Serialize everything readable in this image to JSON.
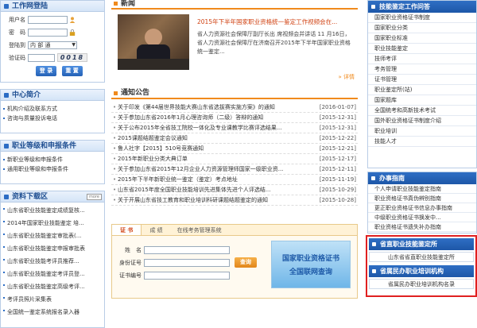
{
  "login": {
    "title": "工作网登陆",
    "user_label": "用户名",
    "pwd_label": "密　码",
    "dept_label": "登陆到",
    "dept_value": "内 部 通",
    "code_label": "验证码",
    "code_value": "0018",
    "login_btn": "登 录",
    "reset_btn": "重 置"
  },
  "center": {
    "title": "中心简介",
    "items": [
      "机构介绍及联系方式",
      "咨询与质量投诉电话"
    ]
  },
  "grade": {
    "title": "职业等级和申报条件",
    "items": [
      "新职业等级和申报条件",
      "通用职业等级和申报条件"
    ]
  },
  "downloads": {
    "title": "资料下载区",
    "more": "more",
    "items": [
      "山东省职业技能鉴定成绩复核...",
      "2014年国家职业技能鉴定 培...",
      "山东省职业技能鉴定审批表(...",
      "山东省职业技能鉴定申报审批表",
      "山东省职业技能考评员推荐...",
      "山东省职业技能鉴定考评员登...",
      "山东省职业技能鉴定高级考评...",
      "考评员照片采集表",
      "全国统一鉴定系统报名录入器"
    ]
  },
  "news": {
    "title": "新闻",
    "more": "详情",
    "headline": "2015年下半年国家职业资格统一鉴定工作视频会在...",
    "summary": "省人力资源社会保障厅副厅长出 席视频会并讲话 11 月16日，省人力资源社会保障厅在济南召开2015年下半年国家职业资格统一鉴定..."
  },
  "notice": {
    "title": "通知公告",
    "items": [
      {
        "t": "关于印发《第44届世界技能大赛山东省选拔赛实施方案》的通知",
        "d": "[2016-01-07]"
      },
      {
        "t": "关于参加山东省2016年1月心理咨询师（二级）答辩的通知",
        "d": "[2015-12-31]"
      },
      {
        "t": "关于公布2015年全省技工院校一体化及专业课教学比赛评选结果...",
        "d": "[2015-12-31]"
      },
      {
        "t": "2015课题结题鉴定会议通知",
        "d": "[2015-12-22]"
      },
      {
        "t": "鲁人社字【2015】510号竞赛通知",
        "d": "[2015-12-21]"
      },
      {
        "t": "2015年新职业分类大典订单",
        "d": "[2015-12-17]"
      },
      {
        "t": "关于参加山东省2015年12月企业人力资源管理师国家一级职业资...",
        "d": "[2015-12-11]"
      },
      {
        "t": "2015年下半年新职业统一鉴定（鉴定）考点地址",
        "d": "[2015-11-19]"
      },
      {
        "t": "山东省2015年度全国职业技能培训先进集体先进个人评选结...",
        "d": "[2015-10-29]"
      },
      {
        "t": "关于开展山东省技工教育和职业培训科研课题结题鉴定的通知",
        "d": "[2015-10-28]"
      }
    ]
  },
  "query": {
    "tabs": [
      "证 书",
      "成 绩",
      "在线考务管理系统"
    ],
    "name_label": "姓　名",
    "id_label": "身份证号",
    "cert_label": "证书编号",
    "query_btn": "查询",
    "banner_line1": "国家职业资格证书",
    "banner_line2": "全国联网查询"
  },
  "skills": {
    "title": "技能鉴定工作问答",
    "items": [
      "国家职业资格证书制度",
      "国家职业分类",
      "国家职业标准",
      "职业技能鉴定",
      "技师考评",
      "考务管理",
      "证书管理",
      "职业鉴定所(站)",
      "国家题库",
      "全国统考和高新技术考试",
      "国外职业资格证书制度介绍",
      "职业培训",
      "技能人才"
    ]
  },
  "guide": {
    "title": "办事指南",
    "items": [
      "个人申请职业技能鉴定指南",
      "职业资格证书真伪辨别指南",
      "更正职业资格证书信息办事指南",
      "中级职业资格证书换发中...",
      "职业资格证书遗失补办指南"
    ]
  },
  "agency": {
    "title": "省直职业技能鉴定所",
    "items": [
      "山东省省直职业技能鉴定所"
    ]
  },
  "training": {
    "title": "省属民办职业培训机构",
    "items": [
      "省属民办职业培训机构名录"
    ]
  },
  "colors": {
    "accent": "#2b6cc4",
    "highlight": "#e02020",
    "orange": "#f08a1c"
  }
}
